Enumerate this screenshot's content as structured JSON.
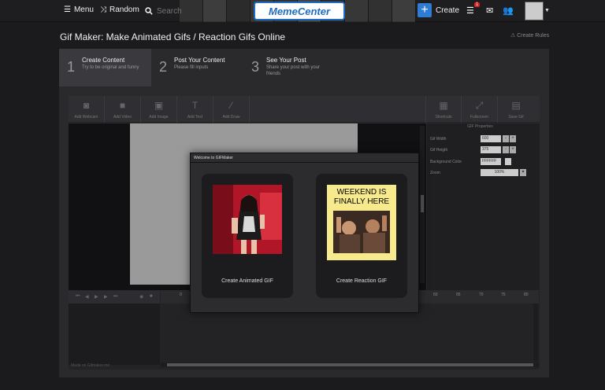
{
  "nav": {
    "menu_label": "Menu",
    "random_label": "Random",
    "search_placeholder": "Search",
    "logo_text": "MemeCenter",
    "create_label": "Create",
    "notification_count": "1"
  },
  "page": {
    "title": "Gif Maker: Make Animated Gifs / Reaction Gifs Online",
    "create_rules": "Create Rules"
  },
  "steps": [
    {
      "num": "1",
      "title": "Create Content",
      "sub": "Try to be original and funny"
    },
    {
      "num": "2",
      "title": "Post Your Content",
      "sub": "Please fill inputs"
    },
    {
      "num": "3",
      "title": "See Your Post",
      "sub": "Share your post with your friends"
    }
  ],
  "toolbar": {
    "add_webcam": "Add Webcam",
    "add_video": "Add Video",
    "add_image": "Add Image",
    "add_text": "Add Text",
    "add_draw": "Add Draw",
    "shortcuts": "Shortcuts",
    "fullscreen": "Fullscreen",
    "save_gif": "Save Gif"
  },
  "properties": {
    "title": "GIF Properties",
    "gif_width_label": "Gif Width",
    "gif_width_value": "600",
    "gif_height_label": "Gif Heigth",
    "gif_height_value": "375",
    "bg_color_label": "Background Color",
    "bg_color_value": "FFFFFF",
    "zoom_label": "Zoom",
    "zoom_value": "100%"
  },
  "timeline": {
    "ticks": [
      "0",
      "60",
      "65",
      "70",
      "75",
      "80"
    ],
    "footer": "Made on Gifmaker.me"
  },
  "modal": {
    "title": "Welcome to GIFMaker",
    "option_animated": "Create Animated GIF",
    "option_reaction": "Create Reaction GIF",
    "meme_text": "WEEKEND IS FINALLY HERE"
  },
  "colors": {
    "accent": "#2f7cd4",
    "badge": "#dd2222",
    "meme_bg": "#f6ea8c"
  }
}
